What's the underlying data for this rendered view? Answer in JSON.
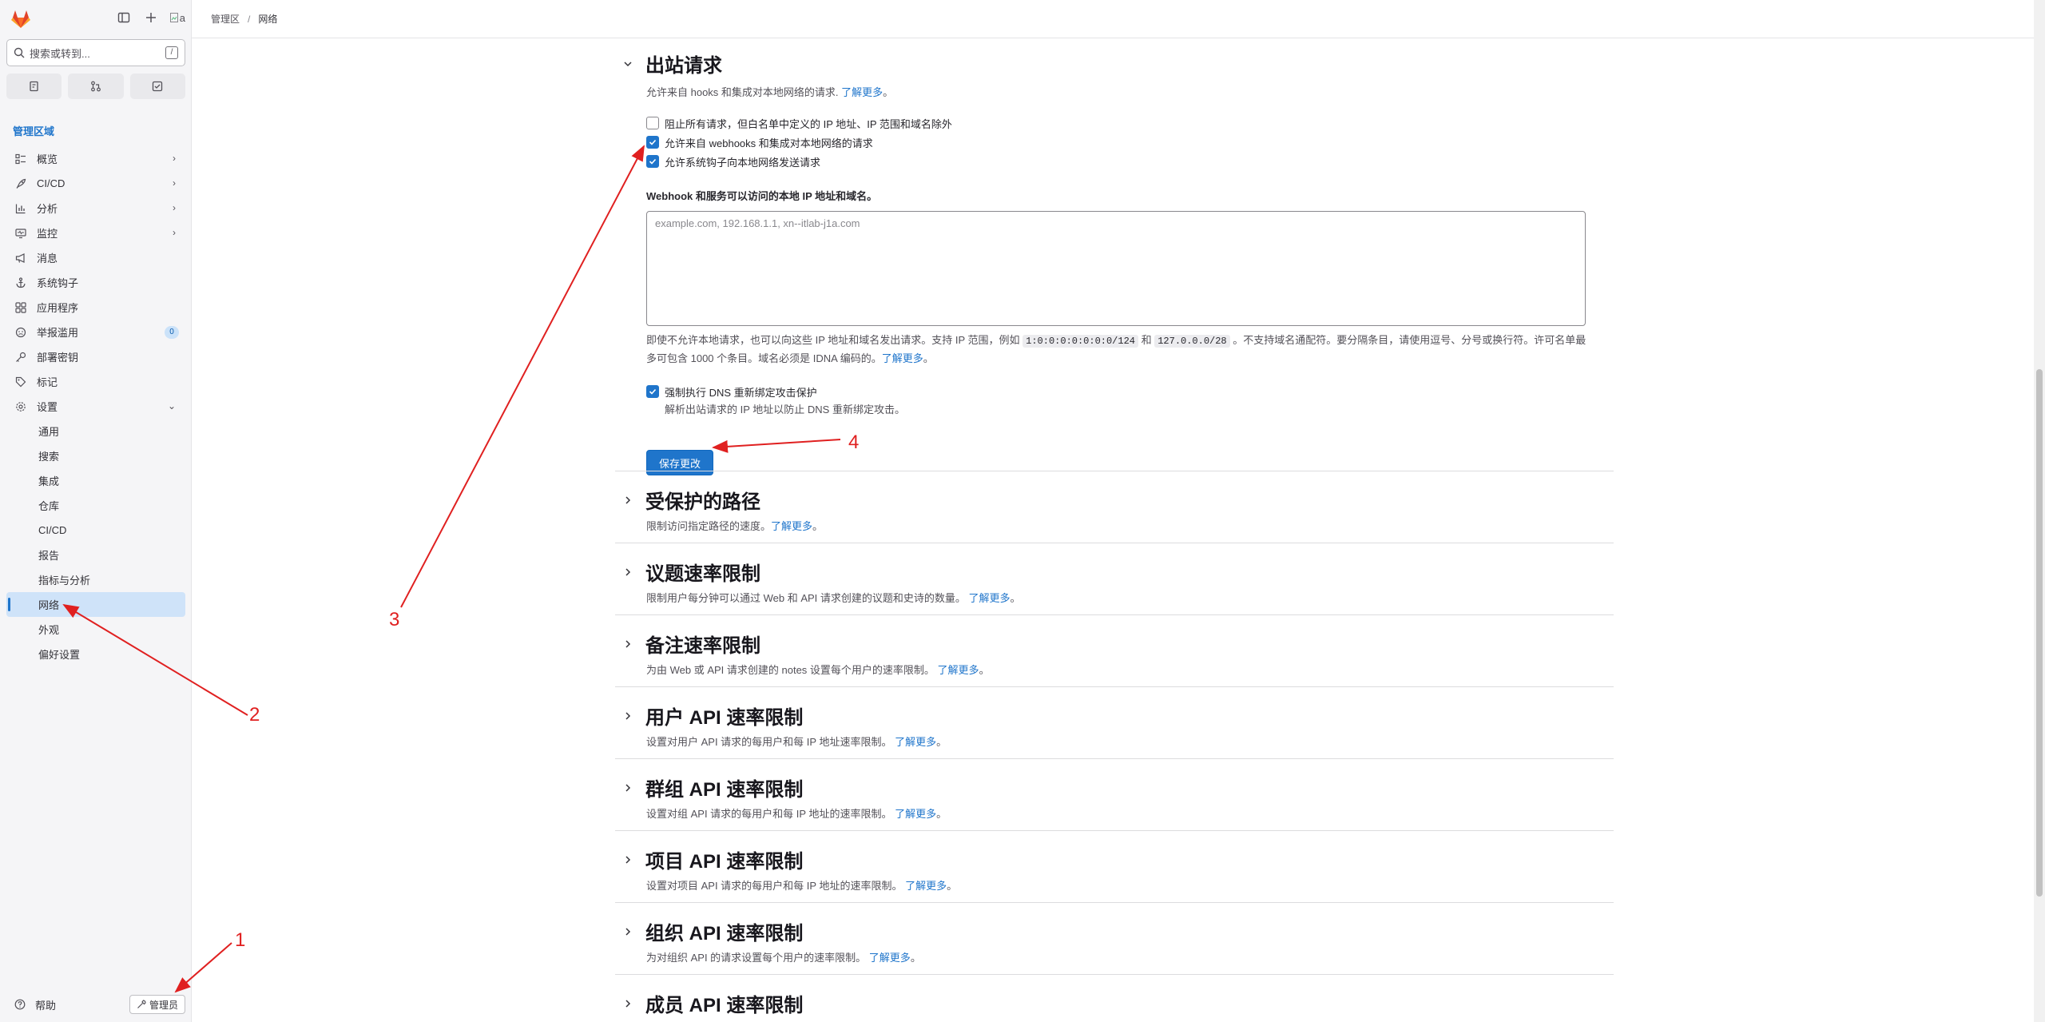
{
  "sidebar": {
    "search_placeholder": "搜索或转到...",
    "search_shortcut": "/",
    "section_title": "管理区域",
    "nav_items": [
      {
        "label": "概览",
        "icon": "overview-icon",
        "chevron": true
      },
      {
        "label": "CI/CD",
        "icon": "rocket-icon",
        "chevron": true
      },
      {
        "label": "分析",
        "icon": "chart-icon",
        "chevron": true
      },
      {
        "label": "监控",
        "icon": "monitor-icon",
        "chevron": true
      },
      {
        "label": "消息",
        "icon": "megaphone-icon",
        "chevron": false
      },
      {
        "label": "系统钩子",
        "icon": "anchor-icon",
        "chevron": false
      },
      {
        "label": "应用程序",
        "icon": "apps-icon",
        "chevron": false
      },
      {
        "label": "举报滥用",
        "icon": "abuse-icon",
        "chevron": false,
        "badge": "0"
      },
      {
        "label": "部署密钥",
        "icon": "key-icon",
        "chevron": false
      },
      {
        "label": "标记",
        "icon": "label-icon",
        "chevron": false
      },
      {
        "label": "设置",
        "icon": "settings-icon",
        "chevron": "down"
      }
    ],
    "sub_items": [
      {
        "label": "通用",
        "active": false
      },
      {
        "label": "搜索",
        "active": false
      },
      {
        "label": "集成",
        "active": false
      },
      {
        "label": "仓库",
        "active": false
      },
      {
        "label": "CI/CD",
        "active": false
      },
      {
        "label": "报告",
        "active": false
      },
      {
        "label": "指标与分析",
        "active": false
      },
      {
        "label": "网络",
        "active": true
      },
      {
        "label": "外观",
        "active": false
      },
      {
        "label": "偏好设置",
        "active": false
      }
    ],
    "help_label": "帮助",
    "admin_label": "管理员",
    "broken_avatar_alt": "a"
  },
  "breadcrumb": {
    "root": "管理区",
    "current": "网络"
  },
  "outbound": {
    "title": "出站请求",
    "desc": "允许来自 hooks 和集成对本地网络的请求. ",
    "learn_more": "了解更多",
    "desc_end": "。",
    "checkboxes": [
      {
        "label": "阻止所有请求，但白名单中定义的 IP 地址、IP 范围和域名除外",
        "checked": false
      },
      {
        "label": "允许来自 webhooks 和集成对本地网络的请求",
        "checked": true
      },
      {
        "label": "允许系统钩子向本地网络发送请求",
        "checked": true
      }
    ],
    "field_label": "Webhook 和服务可以访问的本地 IP 地址和域名。",
    "textarea_placeholder": "example.com, 192.168.1.1, xn--itlab-j1a.com",
    "help_1": "即使不允许本地请求，也可以向这些 IP 地址和域名发出请求。支持 IP 范围，例如 ",
    "code_1": "1:0:0:0:0:0:0:0/124",
    "help_and": " 和 ",
    "code_2": "127.0.0.0/28",
    "help_2": " 。不支持域名通配符。要分隔条目，请使用逗号、分号或换行符。许可名单最多可包含 1000 个条目。域名必须是 IDNA 编码的。",
    "help_link": "了解更多",
    "help_end": "。",
    "dns_label": "强制执行 DNS 重新绑定攻击保护",
    "dns_checked": true,
    "dns_sub": "解析出站请求的 IP 地址以防止 DNS 重新绑定攻击。",
    "save_label": "保存更改"
  },
  "sections": [
    {
      "title": "受保护的路径",
      "desc": "限制访问指定路径的速度。",
      "link": "了解更多",
      "end": "。"
    },
    {
      "title": "议题速率限制",
      "desc": "限制用户每分钟可以通过 Web 和 API 请求创建的议题和史诗的数量。 ",
      "link": "了解更多",
      "end": "。"
    },
    {
      "title": "备注速率限制",
      "desc": "为由 Web 或 API 请求创建的 notes 设置每个用户的速率限制。 ",
      "link": "了解更多",
      "end": "。"
    },
    {
      "title": "用户 API 速率限制",
      "desc": "设置对用户 API 请求的每用户和每 IP 地址速率限制。 ",
      "link": "了解更多",
      "end": "。"
    },
    {
      "title": "群组 API 速率限制",
      "desc": "设置对组 API 请求的每用户和每 IP 地址的速率限制。 ",
      "link": "了解更多",
      "end": "。"
    },
    {
      "title": "项目 API 速率限制",
      "desc": "设置对项目 API 请求的每用户和每 IP 地址的速率限制。 ",
      "link": "了解更多",
      "end": "。"
    },
    {
      "title": "组织 API 速率限制",
      "desc": "为对组织 API 的请求设置每个用户的速率限制。 ",
      "link": "了解更多",
      "end": "。"
    },
    {
      "title": "成员 API 速率限制",
      "desc": "",
      "link": "",
      "end": ""
    }
  ],
  "annotations": [
    "1",
    "2",
    "3",
    "4"
  ],
  "colors": {
    "accent": "#1f75cb",
    "annotation": "#e02020",
    "active_bg": "#cfe3f9"
  }
}
